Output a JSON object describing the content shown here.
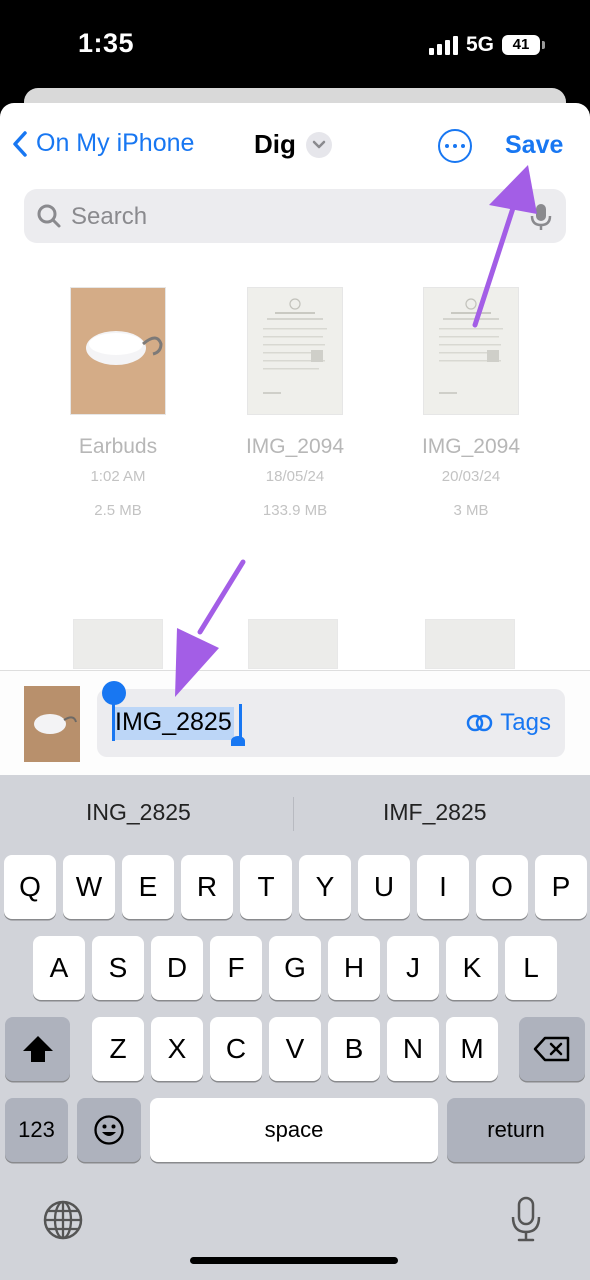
{
  "status": {
    "time": "1:35",
    "network": "5G",
    "battery": "41"
  },
  "nav": {
    "back_label": "On My iPhone",
    "title": "Dig",
    "save_label": "Save"
  },
  "search": {
    "placeholder": "Search"
  },
  "files": [
    {
      "name": "Earbuds",
      "time": "1:02 AM",
      "size": "2.5 MB"
    },
    {
      "name": "IMG_2094",
      "time": "18/05/24",
      "size": "133.9 MB"
    },
    {
      "name": "IMG_2094",
      "time": "20/03/24",
      "size": "3 MB"
    }
  ],
  "filename": {
    "value": "IMG_2825",
    "tags_label": "Tags"
  },
  "suggestions": [
    "ING_2825",
    "IMF_2825"
  ],
  "keyboard": {
    "row1": [
      "Q",
      "W",
      "E",
      "R",
      "T",
      "Y",
      "U",
      "I",
      "O",
      "P"
    ],
    "row2": [
      "A",
      "S",
      "D",
      "F",
      "G",
      "H",
      "J",
      "K",
      "L"
    ],
    "row3": [
      "Z",
      "X",
      "C",
      "V",
      "B",
      "N",
      "M"
    ],
    "numbers_label": "123",
    "space_label": "space",
    "return_label": "return"
  },
  "colors": {
    "accent": "#1877f2",
    "annotation": "#a35ee6",
    "keyboard_bg": "#d1d3d9"
  },
  "icons": [
    "back-chevron-icon",
    "chevron-down-icon",
    "more-icon",
    "search-icon",
    "microphone-icon",
    "tags-icon",
    "shift-icon",
    "delete-icon",
    "emoji-icon",
    "globe-icon"
  ]
}
